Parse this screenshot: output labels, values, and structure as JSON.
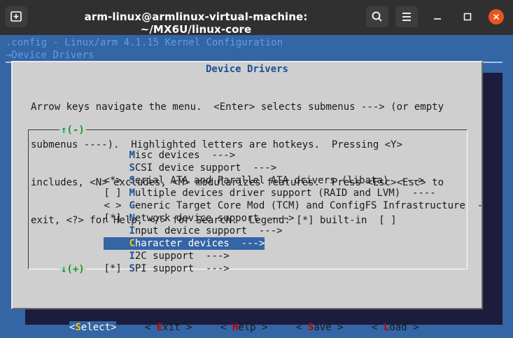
{
  "window": {
    "title": "arm-linux@armlinux-virtual-machine: ~/MX6U/linux-core"
  },
  "terminal": {
    "config_line": ".config - Linux/arm 4.1.15 Kernel Configuration",
    "path_line": "→Device Drivers"
  },
  "dialog": {
    "title": "Device Drivers",
    "help": [
      "Arrow keys navigate the menu.  <Enter> selects submenus ---> (or empty",
      "submenus ----).  Highlighted letters are hotkeys.  Pressing <Y>",
      "includes, <N> excludes, <M> modularizes features.  Press <Esc><Esc> to",
      "exit, <?> for Help, </> for Search.  Legend: [*] built-in  [ ]"
    ],
    "scroll_up": "↑(-)",
    "scroll_down": "↓(+)"
  },
  "menu": {
    "items": [
      {
        "marker": "",
        "hotkey": "M",
        "rest": "isc devices  --->"
      },
      {
        "marker": "",
        "hotkey": "S",
        "rest": "CSI device support  --->"
      },
      {
        "marker": "<*>",
        "hotkey": "S",
        "rest": "erial ATA and Parallel ATA drivers (libata)  --->"
      },
      {
        "marker": "[ ]",
        "hotkey": "M",
        "rest": "ultiple devices driver support (RAID and LVM)  ----"
      },
      {
        "marker": "< >",
        "hotkey": "G",
        "rest": "eneric Target Core Mod (TCM) and ConfigFS Infrastructure  --"
      },
      {
        "marker": "[*]",
        "hotkey": "N",
        "rest": "etwork device support  --->"
      },
      {
        "marker": "",
        "hotkey": "I",
        "rest": "nput device support  --->"
      },
      {
        "marker": "",
        "hotkey": "C",
        "rest": "haracter devices  --->"
      },
      {
        "marker": "",
        "hotkey": "I",
        "rest": "2C support  --->"
      },
      {
        "marker": "[*]",
        "hotkey": "S",
        "rest": "PI support  --->"
      }
    ],
    "selected_index": 7
  },
  "buttons": [
    {
      "pre": "<",
      "hotkey": "S",
      "post": "elect>"
    },
    {
      "pre": "< ",
      "hotkey": "E",
      "post": "xit >"
    },
    {
      "pre": "< ",
      "hotkey": "H",
      "post": "elp >"
    },
    {
      "pre": "< ",
      "hotkey": "S",
      "post": "ave >"
    },
    {
      "pre": "< ",
      "hotkey": "L",
      "post": "oad >"
    }
  ],
  "icons": {
    "new_tab": "new-tab-icon",
    "search": "search-icon",
    "menu": "hamburger-menu-icon",
    "minimize": "minimize-icon",
    "maximize": "maximize-icon",
    "close": "close-icon"
  },
  "colors": {
    "terminal_bg": "#3465a4",
    "dialog_bg": "#cfcfcf",
    "selection": "#3465a4",
    "hotkey_menu": "#1f4f92",
    "hotkey_button": "#c00000",
    "close_button": "#e95420"
  }
}
